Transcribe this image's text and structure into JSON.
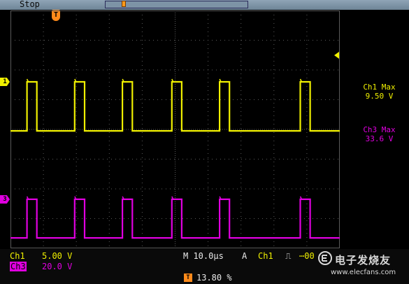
{
  "top_bar": {
    "status": "Stop",
    "trigger_marker": "T",
    "record_marker_icon": "triangle-down-icon"
  },
  "colors": {
    "ch1": "#f0f000",
    "ch3": "#e000e0",
    "grid": "#5a5a5a",
    "background": "#000000",
    "accent": "#ff8a1a"
  },
  "screen": {
    "ch1_marker": "1",
    "ch3_marker": "3",
    "trigger_level_icon": "triangle-left-icon"
  },
  "measurements": [
    {
      "label": "Ch1 Max",
      "value": "9.50 V"
    },
    {
      "label": "Ch3 Max",
      "value": "33.6 V"
    }
  ],
  "bottom": {
    "ch1_label": "Ch1",
    "ch1_scale": "5.00 V",
    "ch3_label": "Ch3",
    "ch3_scale": "20.0 V",
    "timebase": "M 10.0µs",
    "mode": "A",
    "trigger_source": "Ch1",
    "trigger_slope_icon": "rising-edge-icon",
    "trigger_level": "⋯00",
    "position_icon": "T",
    "position": "13.80 %"
  },
  "watermark": {
    "logo_icon": "ef-logo-icon",
    "text": "电子发烧友",
    "url": "www.elecfans.com"
  },
  "chart_data": {
    "type": "line",
    "x_divisions": 10,
    "y_divisions": 8,
    "pulse_starts_div": [
      0.5,
      1.95,
      3.4,
      4.9,
      6.35,
      8.8
    ],
    "pulse_width_div": 0.3,
    "series": [
      {
        "name": "Ch1",
        "low_div": -0.05,
        "high_div": 1.6
      },
      {
        "name": "Ch3",
        "low_div": -3.65,
        "high_div": -2.35
      }
    ]
  }
}
